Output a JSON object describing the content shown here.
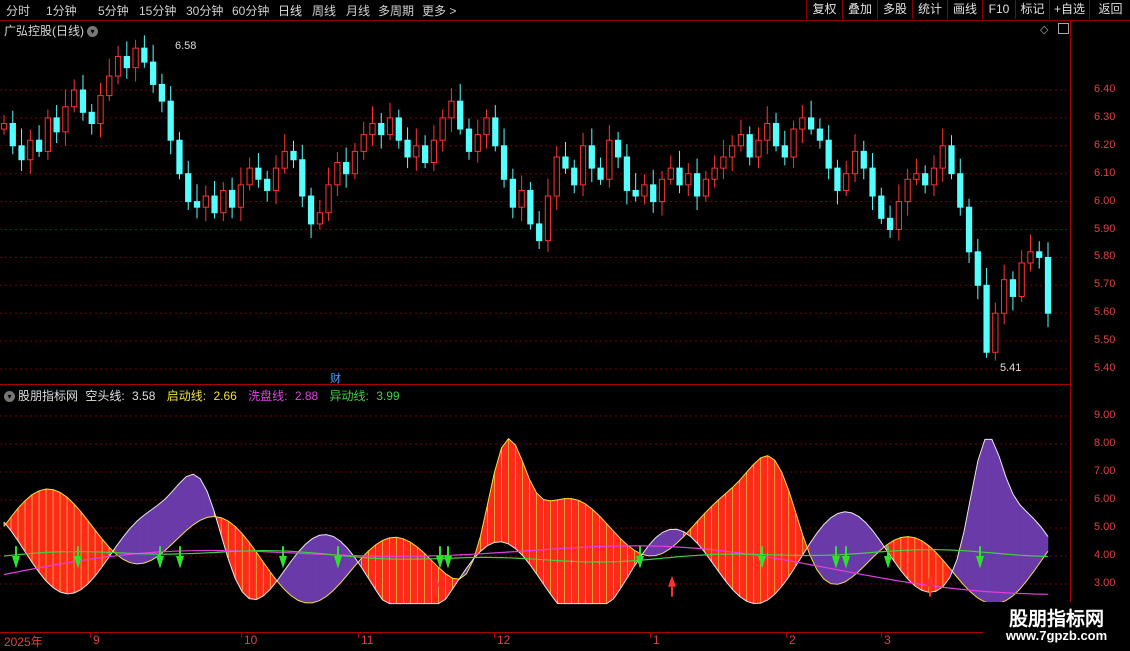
{
  "toolbar": {
    "periods": [
      "分时",
      "1分钟",
      "5分钟",
      "15分钟",
      "30分钟",
      "60分钟",
      "日线",
      "周线",
      "月线",
      "多周期",
      "更多 >"
    ],
    "tools": [
      "复权",
      "叠加",
      "多股",
      "统计",
      "画线",
      "F10",
      "标记",
      "+自选",
      "返回"
    ]
  },
  "stock": {
    "title": "广弘控股(日线)",
    "high_label": "6.58",
    "low_label": "5.41",
    "event_marker": "财",
    "price_axis": [
      "6.40",
      "6.30",
      "6.20",
      "6.10",
      "6.00",
      "5.90",
      "5.80",
      "5.70",
      "5.60",
      "5.50",
      "5.40"
    ]
  },
  "indicator": {
    "name": "股朋指标网",
    "lines": [
      {
        "label": "空头线:",
        "value": "3.58",
        "color": "#e0e0e0"
      },
      {
        "label": "启动线:",
        "value": "2.66",
        "color": "#f0e040"
      },
      {
        "label": "洗盘线:",
        "value": "2.88",
        "color": "#e040e0"
      },
      {
        "label": "异动线:",
        "value": "3.99",
        "color": "#40d040"
      }
    ],
    "axis": [
      "9.00",
      "8.00",
      "7.00",
      "6.00",
      "5.00",
      "4.00",
      "3.00"
    ]
  },
  "dates": [
    "2025年",
    "9",
    "10",
    "11",
    "12",
    "1",
    "2",
    "3"
  ],
  "watermark": {
    "line1": "股朋指标网",
    "line2": "www.7gpzb.com"
  },
  "colors": {
    "up": "#ff3232",
    "down": "#54ffff",
    "grid": "#a00000"
  },
  "chart_data": {
    "type": "candlestick",
    "price_range": [
      5.38,
      6.62
    ],
    "indicator_range": [
      2.0,
      10.0
    ]
  }
}
